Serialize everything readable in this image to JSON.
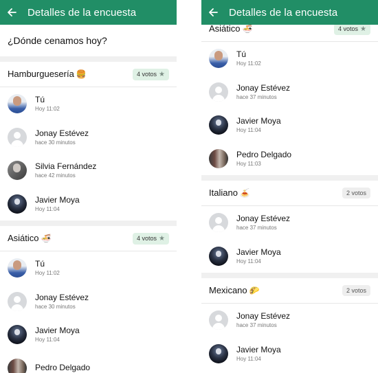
{
  "colors": {
    "app_bar": "#218e66",
    "winner_badge": "#dff1e5",
    "badge": "#eeeeee"
  },
  "left": {
    "header": {
      "title": "Detalles de la encuesta",
      "back_icon": "arrow-left-icon"
    },
    "question": "¿Dónde cenamos hoy?",
    "options": [
      {
        "name": "Hamburguesería",
        "emoji": "🍔",
        "votes": "4 votos",
        "winner": true,
        "voters": [
          {
            "name": "Tú",
            "time": "Hoy 11:02",
            "avatar": "photo-tu"
          },
          {
            "name": "Jonay Estévez",
            "time": "hace 30 minutos",
            "avatar": "generic"
          },
          {
            "name": "Silvia Fernández",
            "time": "hace 42 minutos",
            "avatar": "photo-silvia"
          },
          {
            "name": "Javier Moya",
            "time": "Hoy 11:04",
            "avatar": "photo-javier"
          }
        ]
      },
      {
        "name": "Asiático",
        "emoji": "🍜",
        "votes": "4 votos",
        "winner": true,
        "voters": [
          {
            "name": "Tú",
            "time": "Hoy 11:02",
            "avatar": "photo-tu"
          },
          {
            "name": "Jonay Estévez",
            "time": "hace 30 minutos",
            "avatar": "generic"
          },
          {
            "name": "Javier Moya",
            "time": "Hoy 11:04",
            "avatar": "photo-javier"
          },
          {
            "name": "Pedro Delgado",
            "time": "",
            "avatar": "photo-pedro"
          }
        ]
      }
    ]
  },
  "right": {
    "header": {
      "title": "Detalles de la encuesta",
      "back_icon": "arrow-left-icon"
    },
    "options": [
      {
        "name": "Asiático",
        "emoji": "🍜",
        "votes": "4 votos",
        "winner": true,
        "voters": [
          {
            "name": "Tú",
            "time": "Hoy 11:02",
            "avatar": "photo-tu"
          },
          {
            "name": "Jonay Estévez",
            "time": "hace 37 minutos",
            "avatar": "generic"
          },
          {
            "name": "Javier Moya",
            "time": "Hoy 11:04",
            "avatar": "photo-javier"
          },
          {
            "name": "Pedro Delgado",
            "time": "Hoy 11:03",
            "avatar": "photo-pedro"
          }
        ]
      },
      {
        "name": "Italiano",
        "emoji": "🍝",
        "votes": "2 votos",
        "winner": false,
        "voters": [
          {
            "name": "Jonay Estévez",
            "time": "hace 37 minutos",
            "avatar": "generic"
          },
          {
            "name": "Javier Moya",
            "time": "Hoy 11:04",
            "avatar": "photo-javier"
          }
        ]
      },
      {
        "name": "Mexicano",
        "emoji": "🌮",
        "votes": "2 votos",
        "winner": false,
        "voters": [
          {
            "name": "Jonay Estévez",
            "time": "hace 37 minutos",
            "avatar": "generic"
          },
          {
            "name": "Javier Moya",
            "time": "Hoy 11:04",
            "avatar": "photo-javier"
          }
        ]
      }
    ]
  }
}
